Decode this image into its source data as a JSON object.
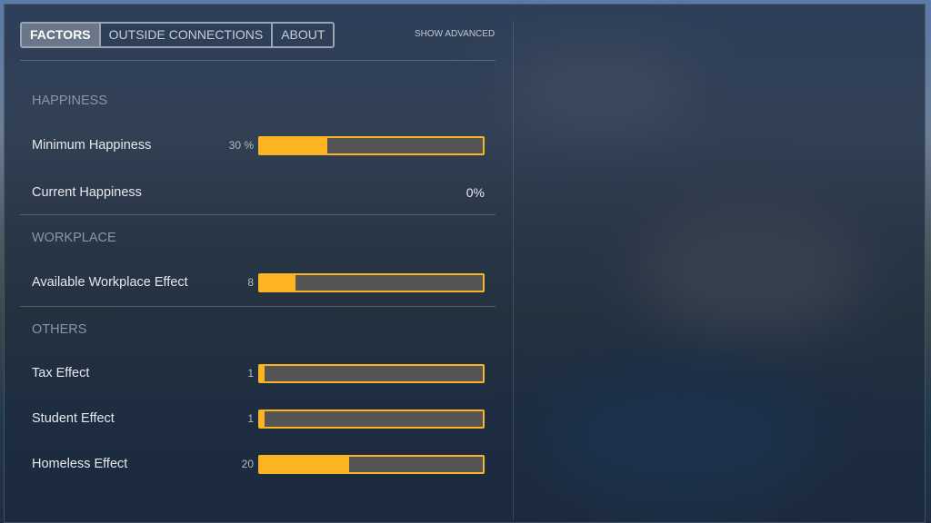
{
  "tabs": [
    {
      "label": "FACTORS",
      "active": true
    },
    {
      "label": "OUTSIDE CONNECTIONS"
    },
    {
      "label": "ABOUT"
    }
  ],
  "show_advanced": "SHOW ADVANCED",
  "colors": {
    "accent": "#fdb422",
    "bar_bg": "#555555"
  },
  "sections": {
    "happiness": {
      "title": "HAPPINESS",
      "minimum": {
        "label": "Minimum Happiness",
        "value": "30 %",
        "fraction": 0.3
      },
      "current": {
        "label": "Current Happiness",
        "value": "0%"
      }
    },
    "workplace": {
      "title": "WORKPLACE",
      "available": {
        "label": "Available Workplace Effect",
        "value": "8",
        "fraction": 0.16
      }
    },
    "others": {
      "title": "OTHERS",
      "tax": {
        "label": "Tax Effect",
        "value": "1",
        "fraction": 0.02
      },
      "student": {
        "label": "Student Effect",
        "value": "1",
        "fraction": 0.02
      },
      "homeless": {
        "label": "Homeless Effect",
        "value": "20",
        "fraction": 0.4
      }
    }
  }
}
